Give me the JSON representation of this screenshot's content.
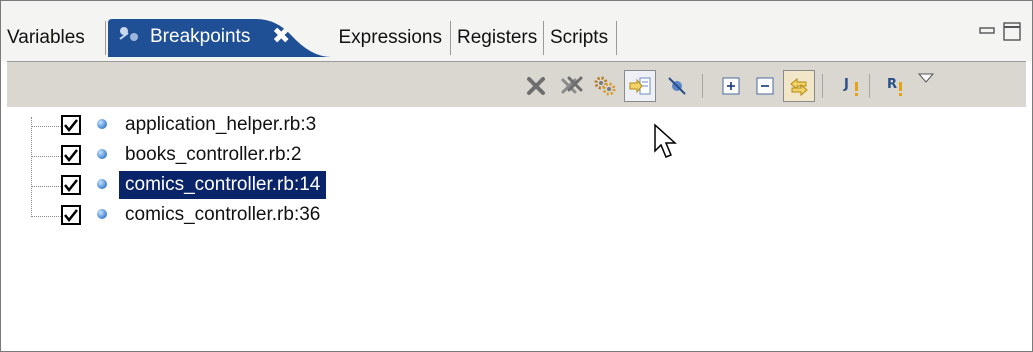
{
  "tabs": [
    {
      "label": "Variables"
    },
    {
      "label": "Breakpoints",
      "active": true,
      "close_glyph": "✖"
    },
    {
      "label": "Expressions"
    },
    {
      "label": "Registers"
    },
    {
      "label": "Scripts"
    }
  ],
  "window_controls": {
    "minimize_icon": "minimize-icon",
    "maximize_icon": "maximize-icon"
  },
  "toolbar": {
    "buttons": [
      {
        "name": "remove-breakpoint-icon"
      },
      {
        "name": "remove-all-breakpoints-icon"
      },
      {
        "name": "show-supported-breakpoints-icon"
      },
      {
        "name": "go-to-file-icon"
      },
      {
        "name": "skip-all-breakpoints-icon"
      },
      {
        "name": "expand-all-icon"
      },
      {
        "name": "collapse-all-icon"
      },
      {
        "name": "link-with-debug-view-icon"
      },
      {
        "name": "java-exception-breakpoint-icon"
      },
      {
        "name": "ruby-exception-breakpoint-icon"
      },
      {
        "name": "view-menu-icon"
      }
    ]
  },
  "breakpoints": [
    {
      "label": "application_helper.rb:3",
      "checked": true,
      "selected": false
    },
    {
      "label": "books_controller.rb:2",
      "checked": true,
      "selected": false
    },
    {
      "label": "comics_controller.rb:14",
      "checked": true,
      "selected": true
    },
    {
      "label": "comics_controller.rb:36",
      "checked": true,
      "selected": false
    }
  ],
  "colors": {
    "active_tab": "#1f4f94",
    "selection": "#0a246a",
    "toolbar_bg": "#d9d7cf"
  }
}
